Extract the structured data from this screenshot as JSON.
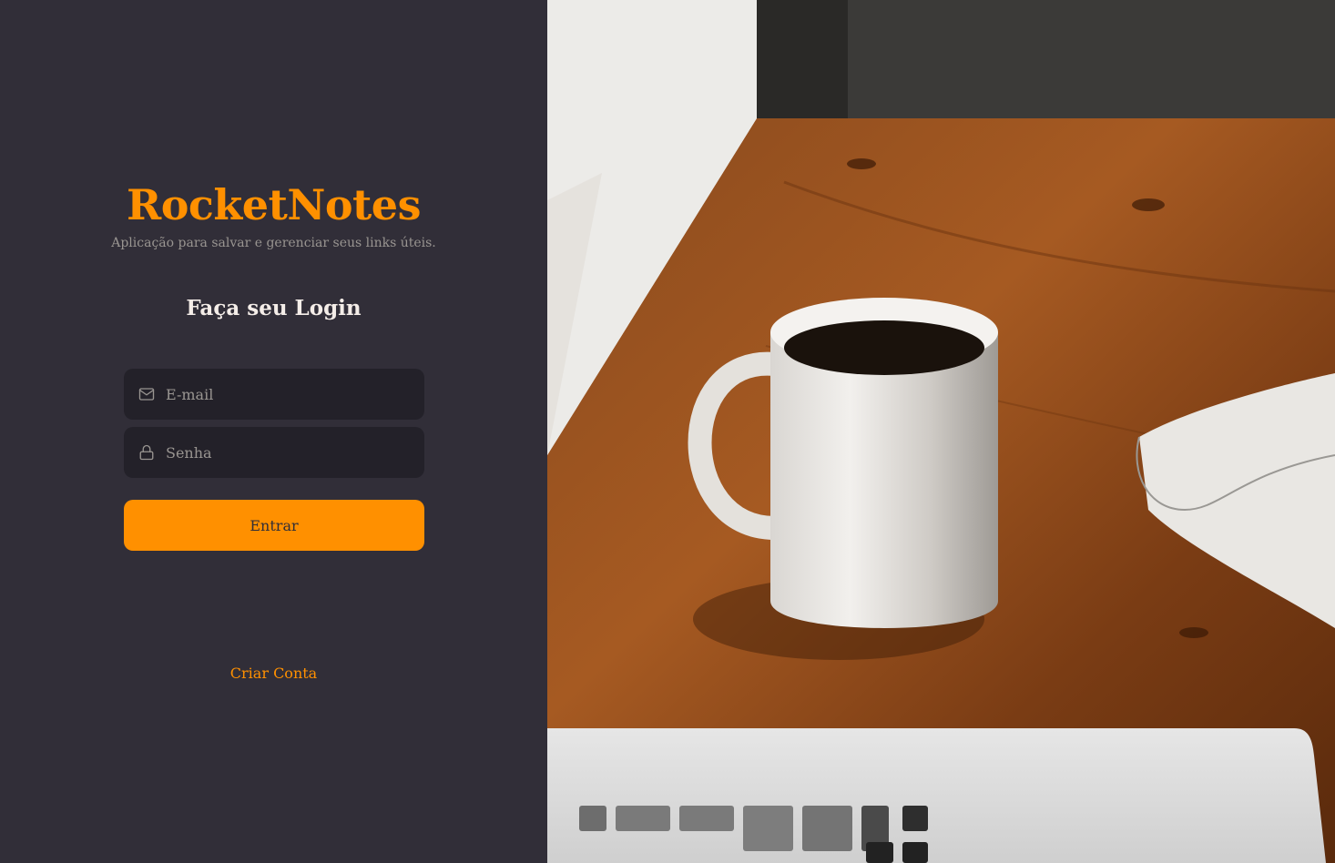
{
  "brand": {
    "title": "RocketNotes",
    "tagline": "Aplicação para salvar e gerenciar seus links úteis."
  },
  "form": {
    "heading": "Faça seu Login",
    "email": {
      "placeholder": "E-mail",
      "value": "",
      "icon": "mail-icon"
    },
    "password": {
      "placeholder": "Senha",
      "value": "",
      "icon": "lock-icon"
    },
    "submit_label": "Entrar"
  },
  "links": {
    "create_account": "Criar Conta"
  },
  "colors": {
    "background": "#312e38",
    "input_background": "#232129",
    "accent": "#ff9000",
    "text_light": "#f4ede8",
    "text_muted": "#999591"
  },
  "hero_image": {
    "icon": "coffee-desk-photo"
  }
}
